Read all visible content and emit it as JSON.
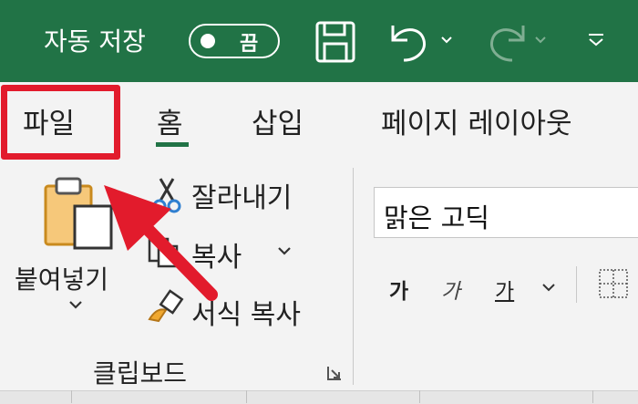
{
  "titlebar": {
    "autosave_label": "자동 저장",
    "autosave_state": "끔",
    "save_icon": "save-icon",
    "undo_icon": "undo-icon",
    "redo_icon": "redo-icon",
    "customize_icon": "customize-quick-access-icon"
  },
  "tabs": [
    {
      "label": "파일"
    },
    {
      "label": "홈"
    },
    {
      "label": "삽입"
    },
    {
      "label": "페이지 레이아웃"
    }
  ],
  "clipboard": {
    "paste_label": "붙여넣기",
    "cut_label": "잘라내기",
    "copy_label": "복사",
    "format_painter_label": "서식 복사",
    "group_label": "클립보드"
  },
  "font": {
    "font_name": "맑은 고딕",
    "bold_label": "가",
    "italic_label": "가",
    "underline_label": "가"
  },
  "colors": {
    "title_green": "#217346",
    "highlight_red": "#e21b2c",
    "arrow_red": "#e21b2c"
  }
}
